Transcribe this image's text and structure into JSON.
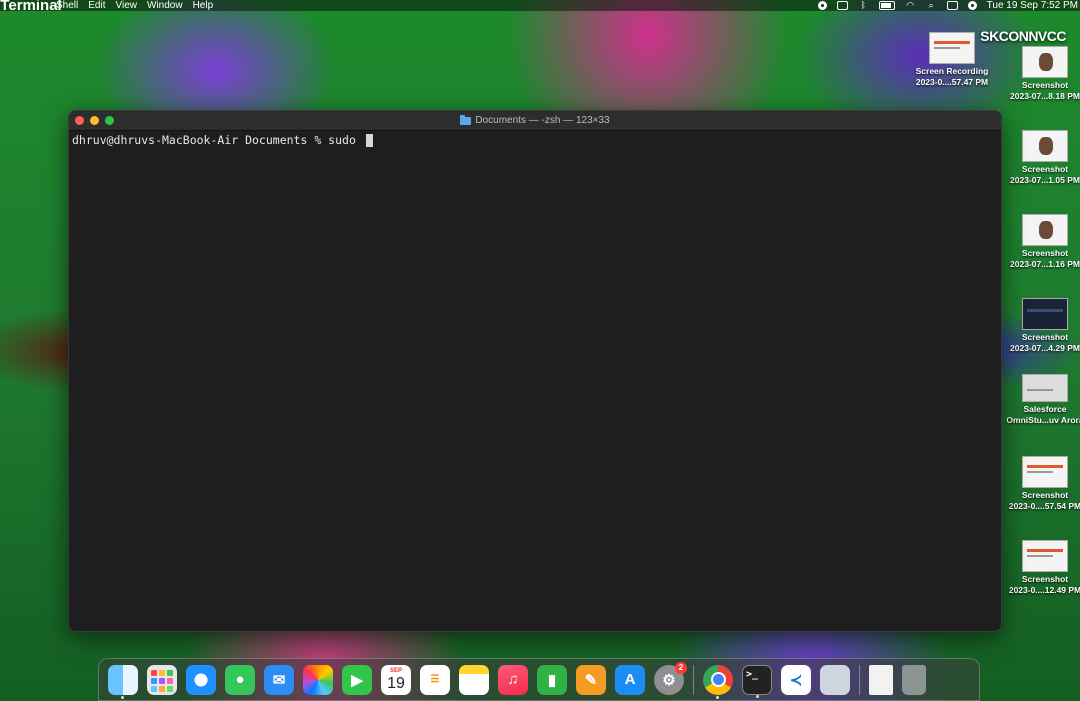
{
  "menubar": {
    "app_name": "Terminal",
    "menus": [
      "Shell",
      "Edit",
      "View",
      "Window",
      "Help"
    ],
    "clock": "Tue 19 Sep  7:52 PM"
  },
  "terminal": {
    "title": "Documents — -zsh — 123×33",
    "prompt": "dhruv@dhruvs-MacBook-Air Documents % sudo "
  },
  "wallpaper": {
    "brand_text": "SKCONNVCC"
  },
  "desktop_icons": [
    {
      "name": "Screen Recording",
      "sub": "2023-0....57.47 PM"
    },
    {
      "name": "Screenshot",
      "sub": "2023-07...8.18 PM"
    },
    {
      "name": "Screenshot",
      "sub": "2023-07...1.05 PM"
    },
    {
      "name": "Screenshot",
      "sub": "2023-07...1.16 PM"
    },
    {
      "name": "Screenshot",
      "sub": "2023-07...4.29 PM"
    },
    {
      "name": "Salesforce",
      "sub": "OmniStu...uv Arora"
    },
    {
      "name": "Screenshot",
      "sub": "2023-0....57.54 PM"
    },
    {
      "name": "Screenshot",
      "sub": "2023-0....12.49 PM"
    }
  ],
  "dock": {
    "apps": [
      {
        "name": "Finder",
        "icon": "finder-icon"
      },
      {
        "name": "Launchpad",
        "icon": "launchpad-icon"
      },
      {
        "name": "Safari",
        "icon": "safari-icon"
      },
      {
        "name": "Messages",
        "icon": "messages-icon"
      },
      {
        "name": "Mail",
        "icon": "mail-icon"
      },
      {
        "name": "Photos",
        "icon": "photos-icon"
      },
      {
        "name": "FaceTime",
        "icon": "facetime-icon"
      },
      {
        "name": "Calendar",
        "icon": "calendar-icon"
      },
      {
        "name": "Reminders",
        "icon": "reminders-icon"
      },
      {
        "name": "Notes",
        "icon": "notes-icon"
      },
      {
        "name": "Music",
        "icon": "music-icon"
      },
      {
        "name": "Numbers",
        "icon": "numbers-icon"
      },
      {
        "name": "Pages",
        "icon": "pages-icon"
      },
      {
        "name": "App Store",
        "icon": "app-store-icon"
      },
      {
        "name": "System Settings",
        "icon": "settings-icon"
      },
      {
        "name": "Google Chrome",
        "icon": "chrome-icon"
      },
      {
        "name": "Terminal",
        "icon": "terminal-icon"
      },
      {
        "name": "Visual Studio Code",
        "icon": "vscode-icon"
      },
      {
        "name": "Preview",
        "icon": "preview-icon"
      },
      {
        "name": "Document",
        "icon": "document-icon"
      },
      {
        "name": "Trash",
        "icon": "trash-icon"
      }
    ],
    "calendar_month": "SEP",
    "calendar_day": "19",
    "settings_badge": "2",
    "terminal_glyph": ">_"
  }
}
